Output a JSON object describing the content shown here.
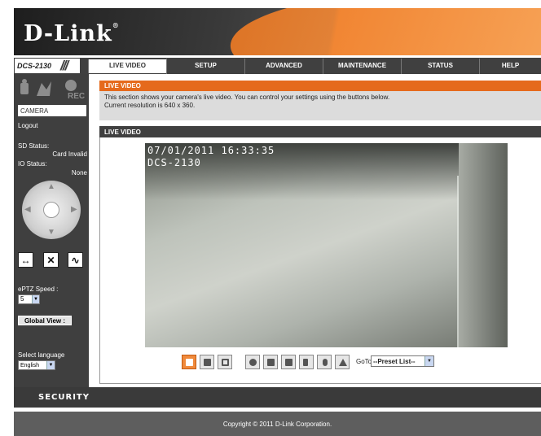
{
  "brand": {
    "logo": "D-Link",
    "mark": "®"
  },
  "model": {
    "name": "DCS-2130",
    "divider": "///"
  },
  "nav": {
    "tabs": [
      "LIVE VIDEO",
      "SETUP",
      "ADVANCED",
      "MAINTENANCE",
      "STATUS",
      "HELP"
    ],
    "active": "LIVE VIDEO"
  },
  "sidebar": {
    "camera_label": "CAMERA",
    "logout_label": "Logout",
    "sd_status_label": "SD Status:",
    "sd_status_value": "Card Invalid",
    "io_status_label": "IO Status:",
    "io_status_value": "None",
    "rec_badge": "REC",
    "eptz_speed_label": "ePTZ Speed :",
    "eptz_speed_value": "5",
    "global_view_label": "Global View :",
    "select_language_label": "Select language",
    "language_value": "English"
  },
  "main": {
    "section_title": "LIVE VIDEO",
    "description_line1": "This section shows your camera's live video. You can control your settings using the buttons below.",
    "description_line2": "Current resolution is 640 x 360.",
    "video_header": "LIVE VIDEO",
    "osd_timestamp": "07/01/2011 16:33:35",
    "osd_camera": "DCS-2130",
    "goto_label": "GoTo",
    "preset_value": "--Preset List--"
  },
  "footer": {
    "security": "SECURITY",
    "copyright": "Copyright © 2011 D-Link Corporation."
  },
  "colors": {
    "accent": "#e56a1c",
    "dark": "#404040"
  }
}
